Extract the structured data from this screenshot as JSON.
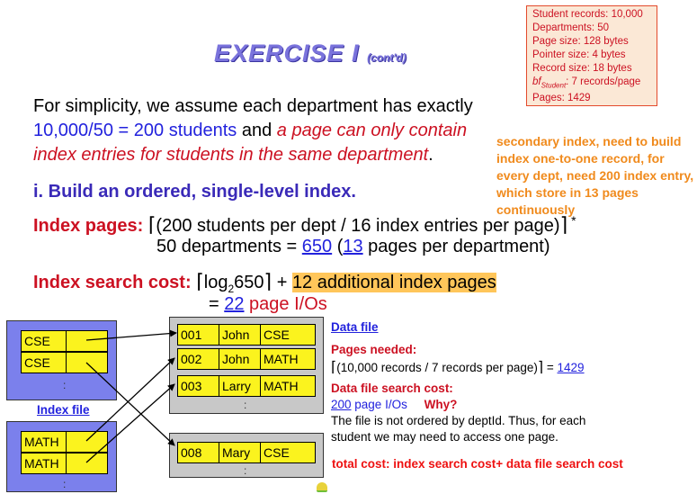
{
  "info_box": {
    "lines": [
      "Student records: 10,000",
      "Departments: 50",
      "Page size: 128 bytes",
      "Pointer size: 4 bytes",
      "Record size: 18 bytes"
    ],
    "bf_prefix": "bf",
    "bf_sub": "Student",
    "bf_value": ": 7 records/page",
    "pages": "Pages: 1429"
  },
  "title": {
    "main": "EXERCISE I",
    "suffix": "(cont'd)"
  },
  "intro": {
    "line1": "For simplicity, we assume each department has exactly",
    "calc": "10,000/50 = 200 students",
    "and": " and ",
    "cond_a": "a page can only contain",
    "cond_b": "index entries for students in the same department",
    "period": "."
  },
  "note": "secondary index, need to build index one-to-one record, for every dept,  need 200 index entry, which store in 13 pages continuously",
  "step": "i.  Build an ordered, single-level index.",
  "index_pages": {
    "label": "Index pages: ",
    "expr1": "(200 students per dept / 16 index entries per page)",
    "star": " *",
    "expr2_prefix": "50 departments = ",
    "value": "650",
    "expr2_open": " (",
    "per_dept": "13",
    "expr2_suffix": " pages per department)"
  },
  "index_search": {
    "label": "Index search cost: ",
    "log": "log",
    "log_sub": "2",
    "log_arg": "650",
    "plus": " + ",
    "additional": "12 additional index pages",
    "eq": "= ",
    "result": "22",
    "unit": " page I/Os"
  },
  "diagram": {
    "index_file_label": "Index file",
    "index_top": [
      "CSE",
      "CSE"
    ],
    "index_bottom": [
      "MATH",
      "MATH"
    ],
    "data_records": [
      [
        "001",
        "John",
        "CSE"
      ],
      [
        "002",
        "John",
        "MATH"
      ],
      [
        "003",
        "Larry",
        "MATH"
      ],
      [
        "008",
        "Mary",
        "CSE"
      ]
    ],
    "dots": ":"
  },
  "datafile": {
    "title": "Data file",
    "pages_needed_label": "Pages needed:",
    "pages_expr": "(10,000 records / 7 records per page)",
    "pages_eq": " = ",
    "pages_value": "1429",
    "search_label": "Data file search cost:",
    "search_value": "200",
    "search_unit": " page I/Os",
    "why": "Why?",
    "expl1": "The file is not ordered by deptId. Thus, for each",
    "expl2": "student we may need to access one page."
  },
  "total": "total cost: index search cost+ data file search cost"
}
